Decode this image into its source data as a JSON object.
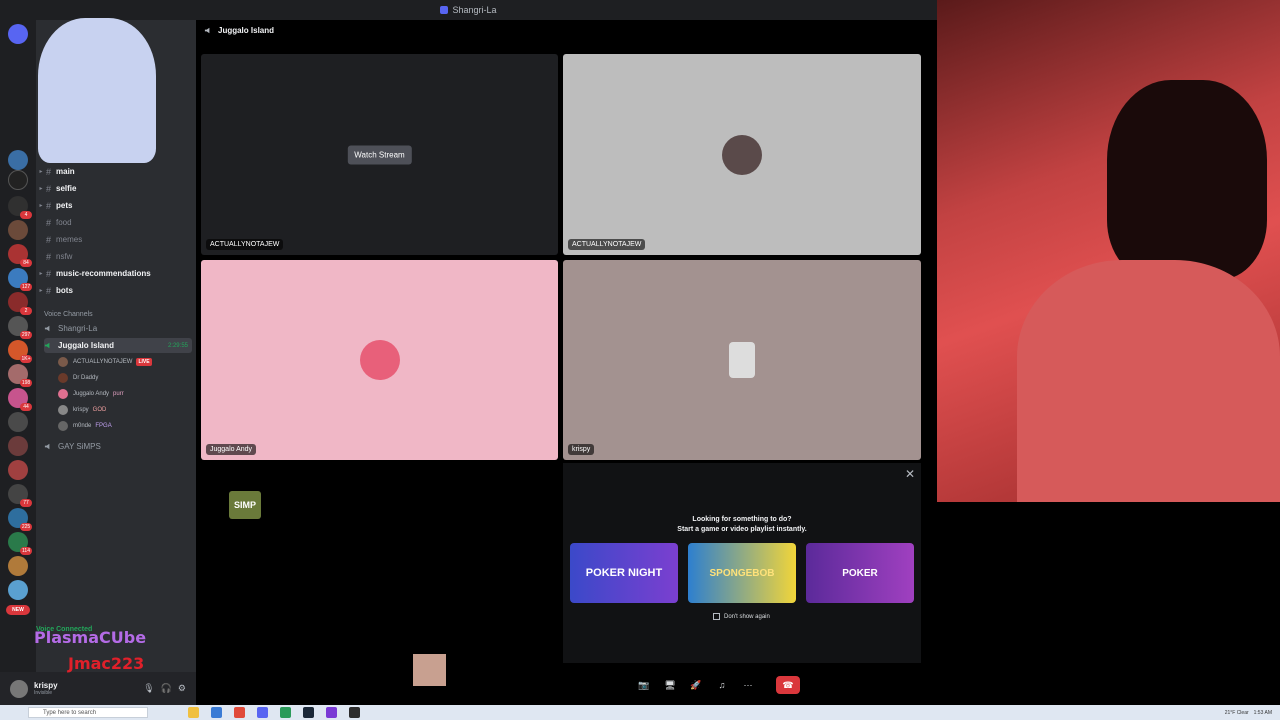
{
  "titlebar": {
    "title": "Shangri-La"
  },
  "voice_header": {
    "channel": "Juggalo Island"
  },
  "channels": [
    {
      "name": "main",
      "unread": true
    },
    {
      "name": "selfie",
      "unread": true
    },
    {
      "name": "pets",
      "unread": true
    },
    {
      "name": "food",
      "unread": false
    },
    {
      "name": "memes",
      "unread": false
    },
    {
      "name": "nsfw",
      "unread": false
    },
    {
      "name": "music-recommendations",
      "unread": true
    },
    {
      "name": "bots",
      "unread": true
    }
  ],
  "voice_category": "Voice Channels",
  "voice_channels": {
    "shangri": "Shangri-La",
    "juggalo": "Juggalo Island",
    "juggalo_timer": "2:29:55",
    "gay": "GAY SiMPS"
  },
  "voice_users": [
    {
      "name": "ACTUALLYNOTAJEW",
      "badge": "LIVE"
    },
    {
      "name": "Dr Daddy",
      "badge": ""
    },
    {
      "name": "Juggalo Andy",
      "badge": "purr"
    },
    {
      "name": "krispy",
      "badge": "GOD"
    },
    {
      "name": "m0nde",
      "badge": "FPGA"
    }
  ],
  "tiles": {
    "stream_button": "Watch Stream",
    "t1_label": "ACTUALLYNOTAJEW",
    "t2_label": "ACTUALLYNOTAJEW",
    "t3_label": "Juggalo Andy",
    "t4_label": "krispy"
  },
  "activity": {
    "heading": "Looking for something to do?",
    "subheading": "Start a game or video playlist instantly.",
    "games": [
      "POKER NIGHT",
      "SPONGEBOB",
      "POKER"
    ],
    "dont_show": "Don't show again"
  },
  "user_panel": {
    "voice_connected": "Voice Connected",
    "username": "krispy",
    "status": "Invisible"
  },
  "overlays": {
    "plasma": "PlasmaCUbe",
    "jmac": "Jmac223",
    "simp_sticker": "SIMP"
  },
  "server_badges": [
    "4",
    "84",
    "127",
    "2",
    "297",
    "1K+",
    "198",
    "44",
    "77",
    "225",
    "114",
    "NEW"
  ],
  "taskbar": {
    "search_placeholder": "Type here to search",
    "weather": "21°F Clear",
    "time": "1:53 AM"
  },
  "colors": {
    "accent": "#5865f2",
    "danger": "#da373c",
    "online": "#23a55a",
    "live_pink": "#f0b7c6",
    "tile_gray": "#bdbdbd",
    "tile_mauve": "#a39290"
  }
}
